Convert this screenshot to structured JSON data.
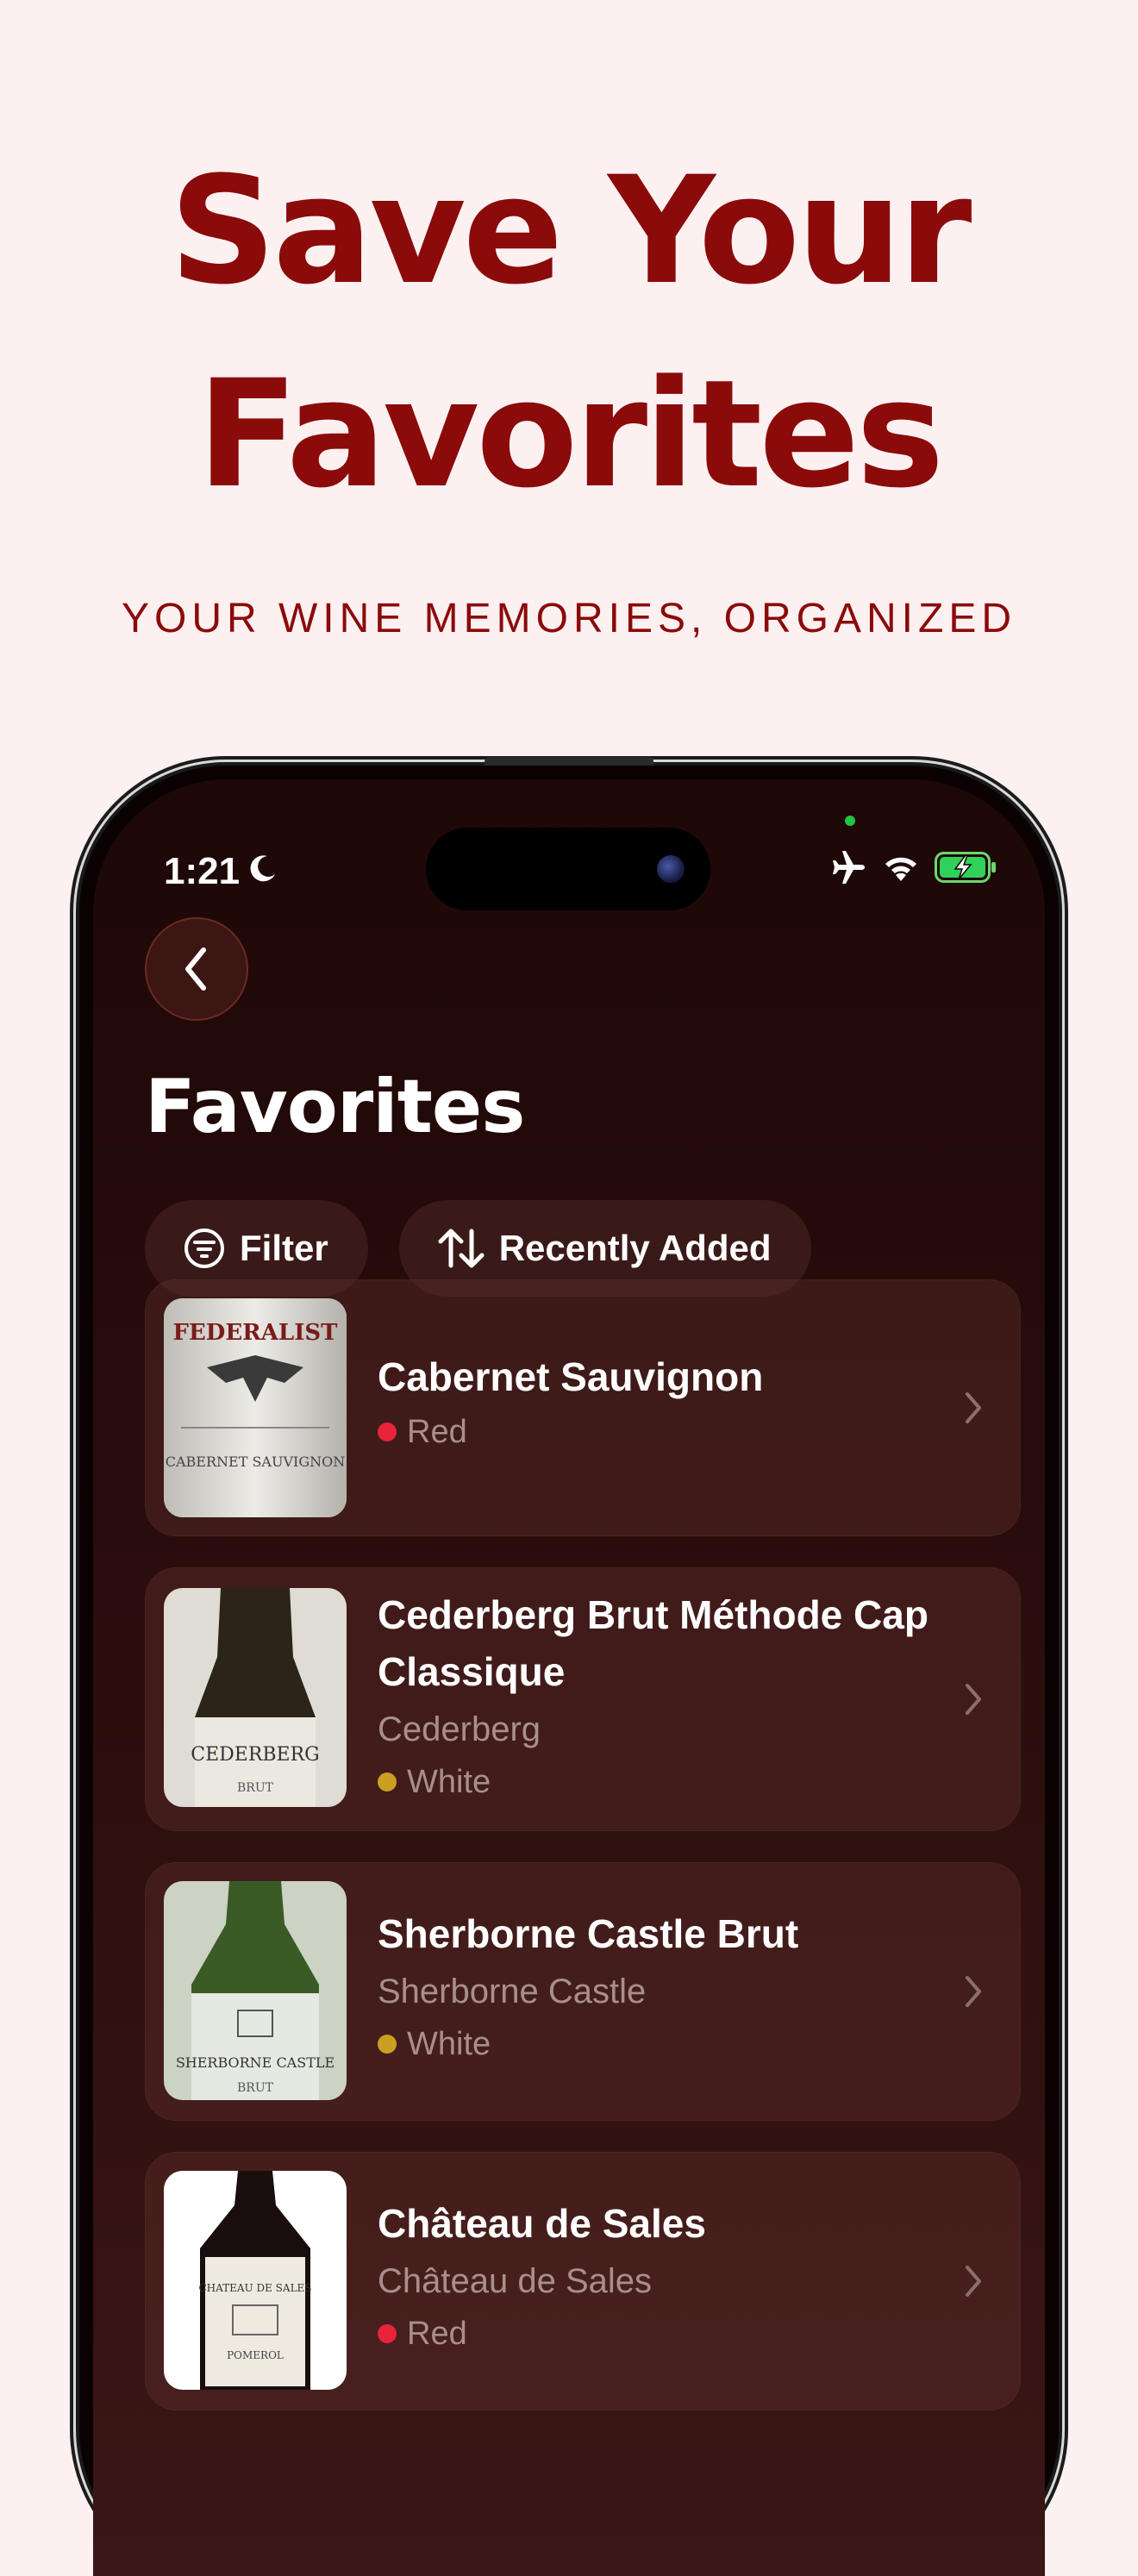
{
  "headline": {
    "line1": "Save Your",
    "line2": "Favorites"
  },
  "subhead": "YOUR WINE MEMORIES, ORGANIZED",
  "status_bar": {
    "time": "1:21",
    "icons": [
      "moon-icon",
      "airplane-icon",
      "wifi-icon",
      "battery-charging-icon"
    ]
  },
  "nav": {
    "back_icon": "chevron-left-icon"
  },
  "page": {
    "title": "Favorites"
  },
  "chips": {
    "filter_label": "Filter",
    "sort_label": "Recently Added"
  },
  "colors": {
    "accent": "#8b0a0a",
    "background": "#fdf0f1",
    "red_dot": "#e8243a",
    "white_dot": "#c9a021"
  },
  "wines": [
    {
      "name": "Cabernet Sauvignon",
      "producer": "",
      "type": "Red"
    },
    {
      "name": "Cederberg Brut Méthode Cap Classique",
      "producer": "Cederberg",
      "type": "White"
    },
    {
      "name": "Sherborne Castle Brut",
      "producer": "Sherborne Castle",
      "type": "White"
    },
    {
      "name": "Château de Sales",
      "producer": "Château de Sales",
      "type": "Red"
    }
  ]
}
